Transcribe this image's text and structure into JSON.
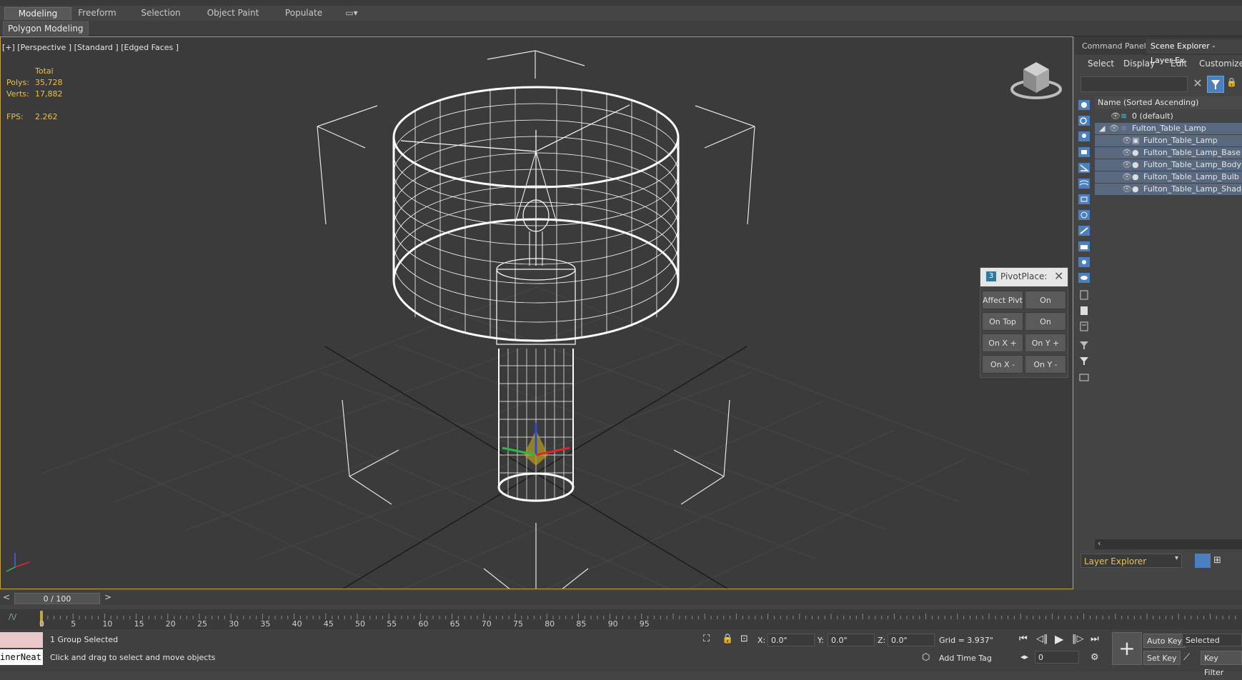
{
  "ribbon": {
    "tabs": [
      "Modeling",
      "Freeform",
      "Selection",
      "Object Paint",
      "Populate"
    ],
    "active_tab": "Modeling",
    "panel_label": "Polygon Modeling"
  },
  "viewport": {
    "label": "[+] [Perspective ] [Standard ] [Edged Faces ]",
    "stats": {
      "total_label": "Total",
      "polys_label": "Polys:",
      "polys_value": "35,728",
      "verts_label": "Verts:",
      "verts_value": "17,882",
      "fps_label": "FPS:",
      "fps_value": "2.262"
    },
    "wire_color": "#ffffff",
    "bg_color": "#3b3b3b"
  },
  "right_panel": {
    "tabs": [
      "Command Panel",
      "Scene Explorer - Layer Ex"
    ],
    "active_tab": "Scene Explorer - Layer Ex",
    "menu": [
      "Select",
      "Display",
      "Edit",
      "Customize"
    ],
    "tree_header": "Name (Sorted Ascending)",
    "tree": [
      {
        "label": "0 (default)",
        "level": 0,
        "type": "layer"
      },
      {
        "label": "Fulton_Table_Lamp",
        "level": 0,
        "type": "layer",
        "expanded": true
      },
      {
        "label": "Fulton_Table_Lamp",
        "level": 1,
        "type": "group"
      },
      {
        "label": "Fulton_Table_Lamp_Base",
        "level": 1,
        "type": "object"
      },
      {
        "label": "Fulton_Table_Lamp_Body",
        "level": 1,
        "type": "object"
      },
      {
        "label": "Fulton_Table_Lamp_Bulb",
        "level": 1,
        "type": "object"
      },
      {
        "label": "Fulton_Table_Lamp_Shade",
        "level": 1,
        "type": "object"
      }
    ],
    "explorer_dropdown": "Layer Explorer"
  },
  "pivot_place": {
    "title": "PivotPlace:",
    "buttons": [
      [
        "Affect Pivt",
        "On Center"
      ],
      [
        "On Top",
        "On Bottom"
      ],
      [
        "On X +",
        "On Y +"
      ],
      [
        "On X -",
        "On Y -"
      ]
    ]
  },
  "timeline": {
    "slider_label": "0 / 100",
    "prev": "<",
    "next": ">",
    "ticks": [
      "0",
      "5",
      "10",
      "15",
      "20",
      "25",
      "30",
      "35",
      "40",
      "45",
      "50",
      "55",
      "60",
      "65",
      "70",
      "75",
      "80",
      "85",
      "90",
      "95"
    ]
  },
  "status": {
    "selection": "1 Group Selected",
    "prompt": "Click and drag to select and move objects",
    "maxscript": "inerNeat",
    "x_label": "X:",
    "x_value": "0.0\"",
    "y_label": "Y:",
    "y_value": "0.0\"",
    "z_label": "Z:",
    "z_value": "0.0\"",
    "grid": "Grid = 3.937\"",
    "add_time_tag": "Add Time Tag",
    "auto_key": "Auto Key",
    "set_key": "Set Key",
    "selected": "Selected",
    "key_filters": "Key Filter",
    "frame_value": "0"
  }
}
